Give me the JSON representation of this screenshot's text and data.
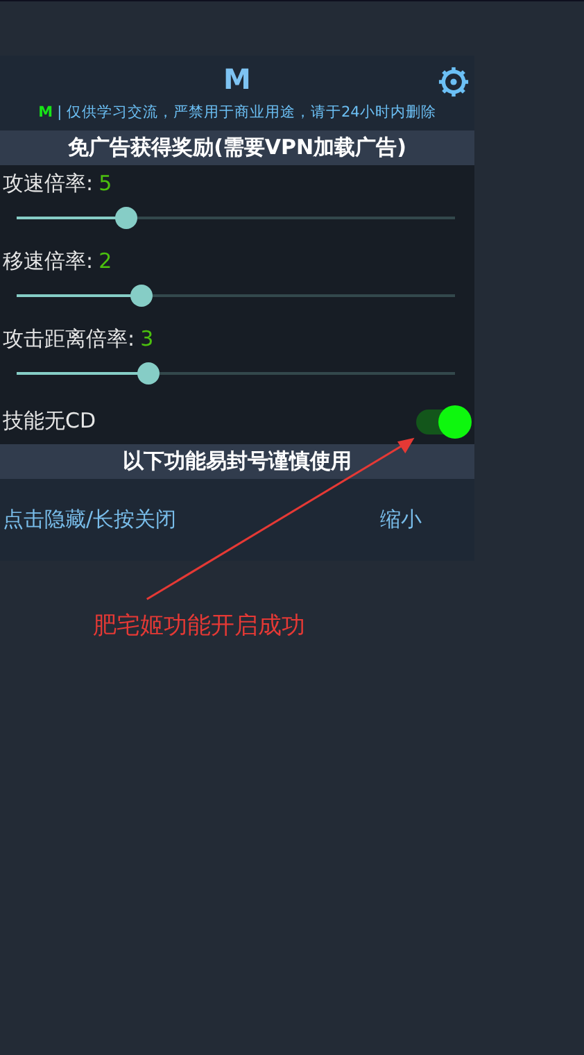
{
  "panel": {
    "title": "M",
    "notice": {
      "tag": "M",
      "text": "| 仅供学习交流，严禁用于商业用途，请于24小时内删除"
    },
    "sections": [
      {
        "heading": "免广告获得奖励(需要VPN加载广告)",
        "items": [
          {
            "kind": "slider",
            "label": "攻速倍率:",
            "value": "5",
            "level": 0.25
          },
          {
            "kind": "slider",
            "label": "移速倍率:",
            "value": "2",
            "level": 0.285
          },
          {
            "kind": "slider",
            "label": "攻击距离倍率:",
            "value": "3",
            "level": 0.3
          },
          {
            "kind": "toggle",
            "label": "技能无CD",
            "on": true
          }
        ]
      },
      {
        "heading": "以下功能易封号谨慎使用"
      }
    ],
    "footer": {
      "hide_link": "点击隐藏/长按关闭",
      "shrink_link": "缩小"
    }
  },
  "annotation": {
    "text": "肥宅姬功能开启成功"
  }
}
